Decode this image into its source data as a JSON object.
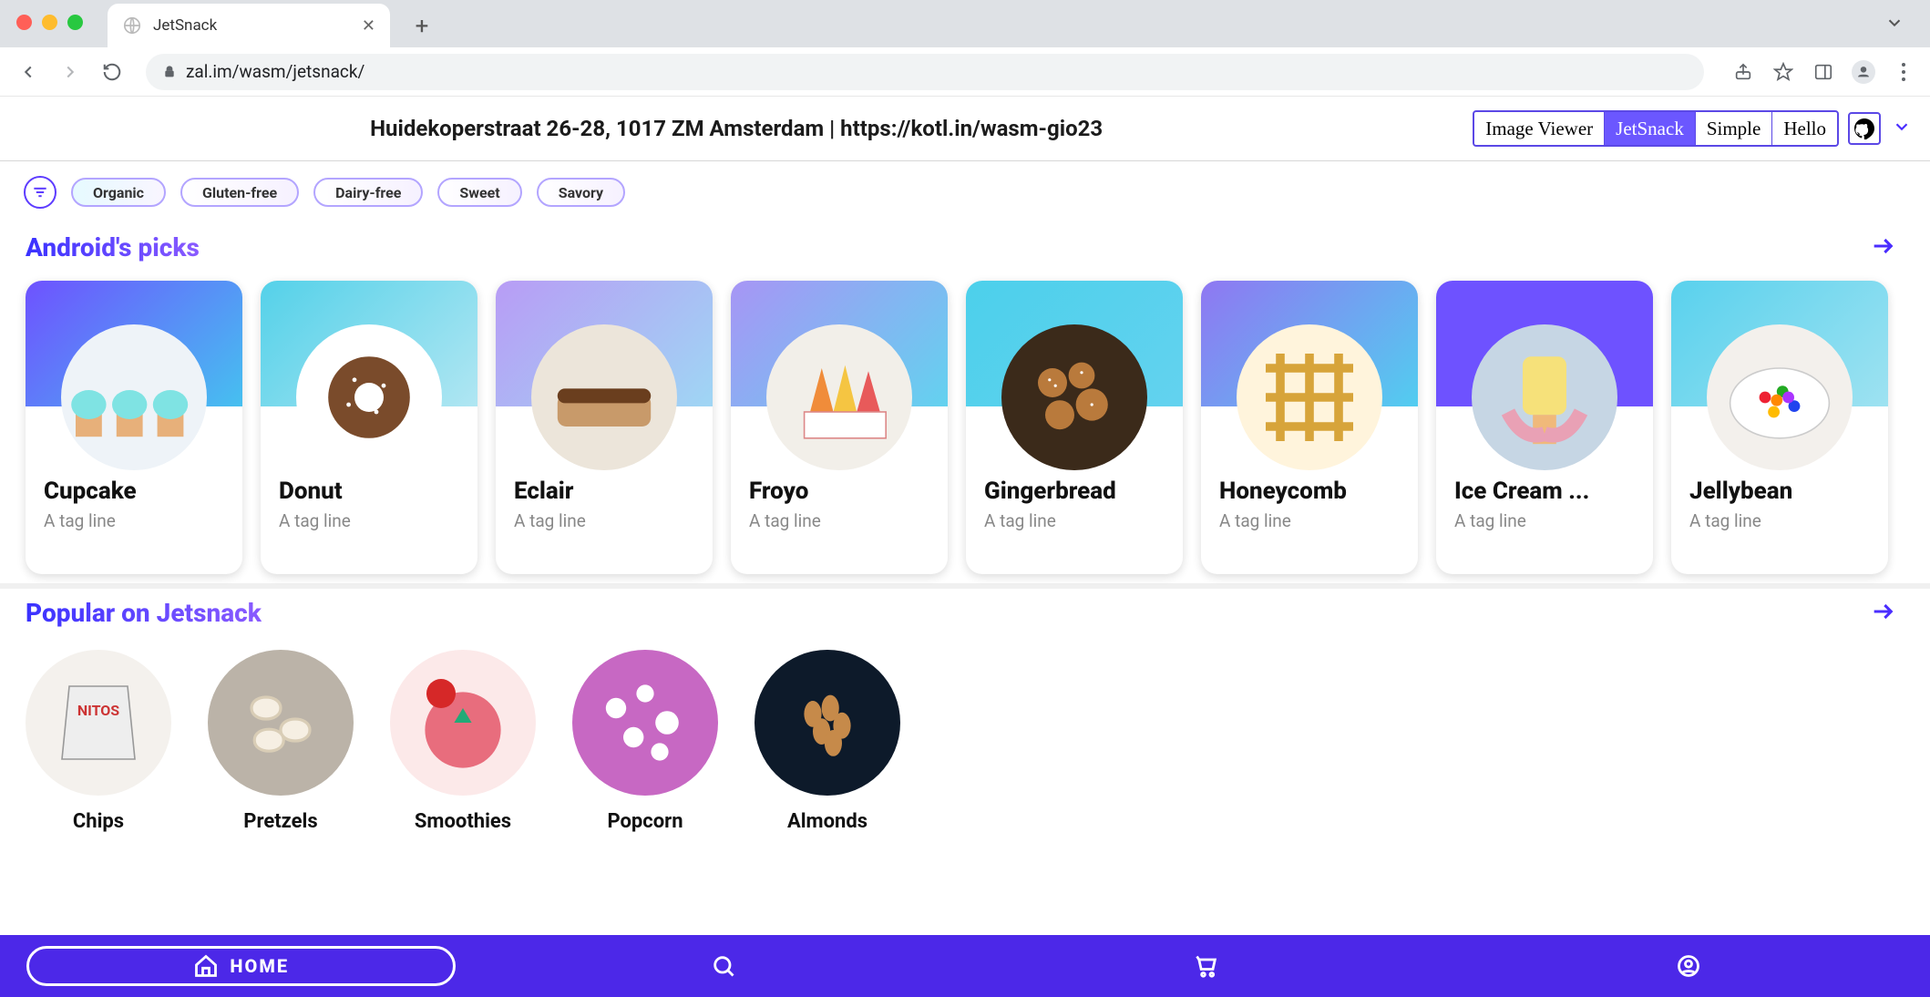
{
  "browser": {
    "tab_title": "JetSnack",
    "url": "zal.im/wasm/jetsnack/"
  },
  "header": {
    "conference_label": "Huidekoperstraat 26-28, 1017 ZM Amsterdam | https://kotl.in/wasm-gio23",
    "demo_tabs": [
      "Image Viewer",
      "JetSnack",
      "Simple",
      "Hello"
    ],
    "active_demo_tab": 1
  },
  "filters": {
    "chips": [
      "Organic",
      "Gluten-free",
      "Dairy-free",
      "Sweet",
      "Savory"
    ]
  },
  "sections": {
    "picks": {
      "title": "Android's picks",
      "cards": [
        {
          "name": "Cupcake",
          "tagline": "A tag line",
          "icon": "cupcake"
        },
        {
          "name": "Donut",
          "tagline": "A tag line",
          "icon": "donut"
        },
        {
          "name": "Eclair",
          "tagline": "A tag line",
          "icon": "eclair"
        },
        {
          "name": "Froyo",
          "tagline": "A tag line",
          "icon": "froyo"
        },
        {
          "name": "Gingerbread",
          "tagline": "A tag line",
          "icon": "gingerbread"
        },
        {
          "name": "Honeycomb",
          "tagline": "A tag line",
          "icon": "honeycomb"
        },
        {
          "name": "Ice Cream ...",
          "tagline": "A tag line",
          "icon": "icecream"
        },
        {
          "name": "Jellybean",
          "tagline": "A tag line",
          "icon": "jellybean"
        }
      ]
    },
    "popular": {
      "title": "Popular on Jetsnack",
      "items": [
        {
          "name": "Chips",
          "icon": "chips"
        },
        {
          "name": "Pretzels",
          "icon": "pretzels"
        },
        {
          "name": "Smoothies",
          "icon": "smoothies"
        },
        {
          "name": "Popcorn",
          "icon": "popcorn"
        },
        {
          "name": "Almonds",
          "icon": "almonds"
        }
      ]
    }
  },
  "bottom_nav": {
    "home_label": "HOME",
    "items": [
      "home",
      "search",
      "cart",
      "profile"
    ]
  },
  "colors": {
    "accent": "#4c28e8",
    "gradient_text_start": "#3a32ff",
    "gradient_text_end": "#8a5bff"
  }
}
